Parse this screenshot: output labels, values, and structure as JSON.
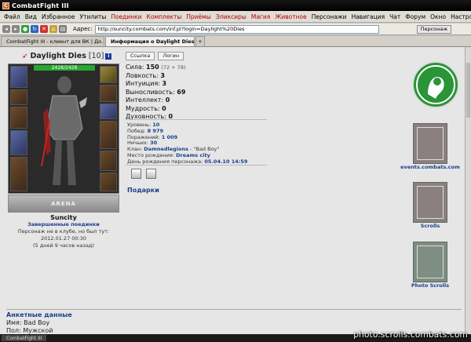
{
  "window": {
    "title": "CombatFight III"
  },
  "menu": [
    "Файл",
    "Вид",
    "Избранное",
    "Утилиты",
    "Поединки",
    "Комплекты",
    "Приёмы",
    "Эликсиры",
    "Магия",
    "Животное",
    "Персонажи",
    "Навигация",
    "Чат",
    "Форум",
    "Окно",
    "Настройки",
    "?"
  ],
  "menu_highlight": [
    4,
    5,
    6,
    7,
    8,
    9
  ],
  "toolbar": {
    "address_label": "Адрес:",
    "address_value": "http://suncity.combats.com/inf.pl?login=Daylight%20Dies",
    "person_button": "Персонаж"
  },
  "tabs": [
    {
      "label": "CombatFight III - клиент для ВК | До...",
      "active": false
    },
    {
      "label": "Информация о Daylight Dies",
      "active": true
    }
  ],
  "character": {
    "name": "Daylight Dies",
    "level": "[10]",
    "info_icon": "i",
    "hp": "2428/2428",
    "city_banner": "ARENA",
    "city": "Suncity",
    "fights_link": "Завершенные поединки",
    "status": "Персонаж не в клубе, но был тут:",
    "last_seen": "2012.01.27 00:30",
    "ago": "(5 дней 9 часов назад)"
  },
  "buttons": {
    "link": "Ссылка",
    "login": "Логин"
  },
  "stats": [
    {
      "label": "Сила:",
      "value": "150",
      "extra": "(72 + 78)"
    },
    {
      "label": "Ловкость:",
      "value": "3",
      "extra": ""
    },
    {
      "label": "Интуиция:",
      "value": "3",
      "extra": ""
    },
    {
      "label": "Выносливость:",
      "value": "69",
      "extra": ""
    },
    {
      "label": "Интеллект:",
      "value": "0",
      "extra": ""
    },
    {
      "label": "Мудрость:",
      "value": "0",
      "extra": ""
    },
    {
      "label": "Духовность:",
      "value": "0",
      "extra": ""
    }
  ],
  "details": [
    {
      "label": "Уровень:",
      "value": "10"
    },
    {
      "label": "Побед:",
      "value": "8 979"
    },
    {
      "label": "Поражений:",
      "value": "1 009"
    },
    {
      "label": "Ничьих:",
      "value": "30"
    },
    {
      "label": "Клан:",
      "value": "Damnedlegions",
      "extra": " - \"Bad Boy\""
    },
    {
      "label": "Место рождения:",
      "value": "Dreams city"
    },
    {
      "label": "День рождения персонажа:",
      "value": "05.04.10 14:59"
    }
  ],
  "gifts_label": "Подарки",
  "right_panel": [
    {
      "label": "events.combats.com"
    },
    {
      "label": "Scrolls"
    },
    {
      "label": "Photo Scrolls"
    }
  ],
  "anket": {
    "heading": "Анкетные данные",
    "name_label": "Имя:",
    "name_value": "Bad Boy",
    "sex_label": "Пол:",
    "sex_value": "Мужской"
  },
  "taskbar": {
    "app": "CombatFight III"
  },
  "watermark": "photo.scrolls.combats.com",
  "colors": {
    "accent_link": "#1b3f8c",
    "hp_bar": "#27a82f",
    "menu_highlight": "#b30000"
  }
}
